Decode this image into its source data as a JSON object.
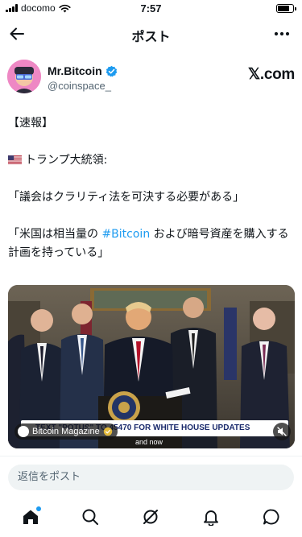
{
  "status_bar": {
    "carrier": "docomo",
    "time": "7:57",
    "battery_level": 0.7
  },
  "header": {
    "title": "ポスト",
    "back_icon": "arrow-left-icon",
    "more_icon": "more-horizontal-icon"
  },
  "author": {
    "name": "Mr.Bitcoin",
    "handle": "@coinspace_",
    "verified": true,
    "source": "𝕏.com"
  },
  "post": {
    "line1": "【速報】",
    "line2": "トランプ大統領:",
    "line3": "「議会はクラリティ法を可決する必要がある」",
    "line4_pre": "「米国は相当量の ",
    "line4_hashtag": "#Bitcoin",
    "line4_post": " および暗号資産を購入する計画を持っている」"
  },
  "media": {
    "brand": "Bitcoin Magazine",
    "ticker_text": "TEXT \"POTUS\" TO 45470 FOR WHITE HOUSE UPDATES",
    "ticker_sub": "and now"
  },
  "reply": {
    "placeholder": "返信をポスト"
  },
  "tab_bar": {
    "items": [
      {
        "icon": "home-icon",
        "active": true
      },
      {
        "icon": "search-icon",
        "active": false
      },
      {
        "icon": "grok-icon",
        "active": false
      },
      {
        "icon": "bell-icon",
        "active": false
      },
      {
        "icon": "message-icon",
        "active": false
      }
    ]
  },
  "colors": {
    "accent": "#1d9bf0",
    "text": "#0f1419",
    "secondary": "#536471"
  }
}
